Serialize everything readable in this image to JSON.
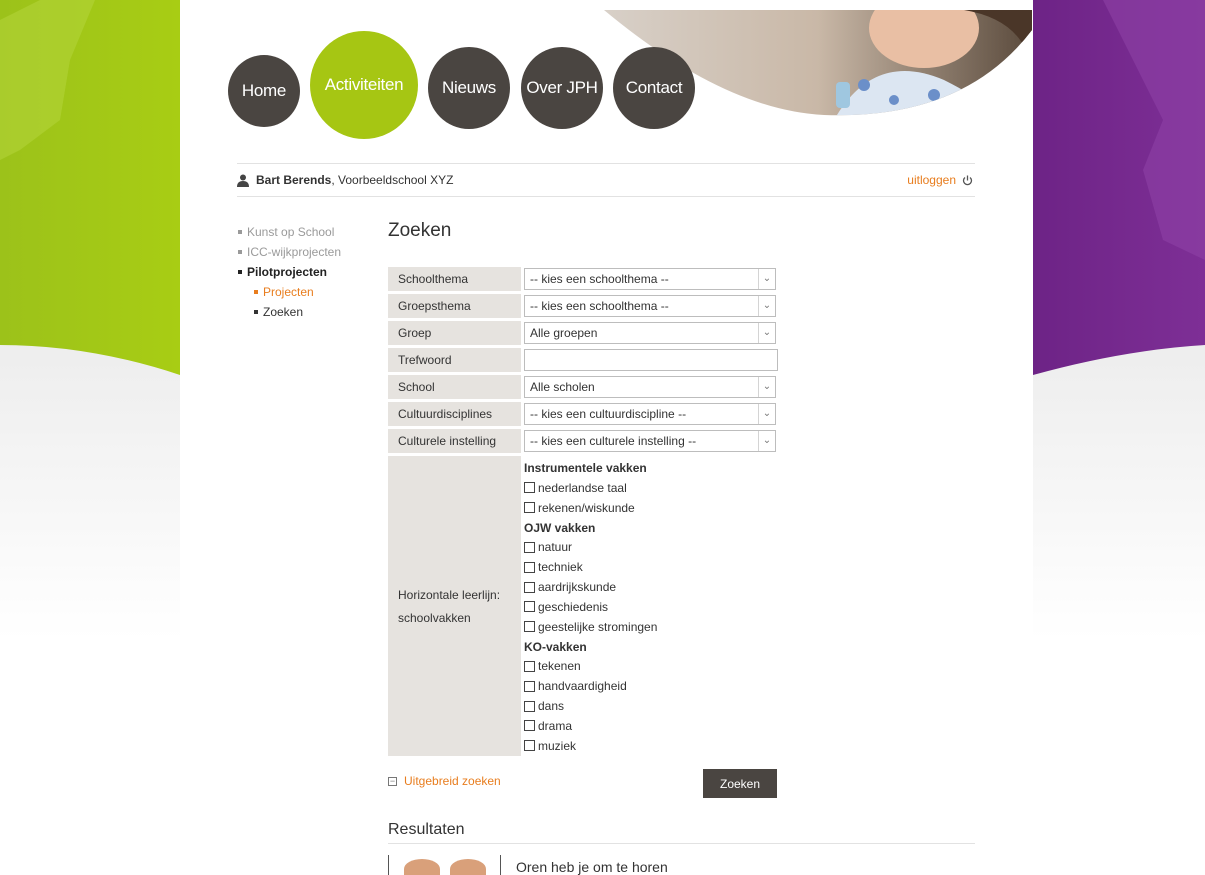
{
  "nav": [
    {
      "label": "Home",
      "active": false
    },
    {
      "label": "Activiteiten",
      "active": true
    },
    {
      "label": "Nieuws",
      "active": false
    },
    {
      "label": "Over JPH",
      "active": false
    },
    {
      "label": "Contact",
      "active": false
    }
  ],
  "user": {
    "name": "Bart Berends",
    "school": ", Voorbeeldschool XYZ",
    "icon": "user-icon"
  },
  "logout": {
    "label": "uitloggen",
    "icon": "power-icon"
  },
  "sidebar": {
    "items": [
      {
        "label": "Kunst op School"
      },
      {
        "label": "ICC-wijkprojecten"
      },
      {
        "label": "Pilotprojecten"
      }
    ],
    "subitems": [
      {
        "label": "Projecten"
      },
      {
        "label": "Zoeken"
      }
    ]
  },
  "page_title": "Zoeken",
  "form": {
    "schoolthema": {
      "label": "Schoolthema",
      "value": "-- kies een schoolthema --"
    },
    "groepsthema": {
      "label": "Groepsthema",
      "value": "-- kies een schoolthema --"
    },
    "groep": {
      "label": "Groep",
      "value": "Alle groepen"
    },
    "trefwoord": {
      "label": "Trefwoord",
      "value": ""
    },
    "school": {
      "label": "School",
      "value": "Alle scholen"
    },
    "cultuurdisciplines": {
      "label": "Cultuurdisciplines",
      "value": "-- kies een cultuurdiscipline --"
    },
    "culturele_instelling": {
      "label": "Culturele instelling",
      "value": "-- kies een culturele instelling --"
    },
    "leerlijn": {
      "label_line1": "Horizontale leerlijn:",
      "label_line2": "schoolvakken",
      "groups": [
        {
          "title": "Instrumentele vakken",
          "items": [
            "nederlandse taal",
            "rekenen/wiskunde"
          ]
        },
        {
          "title": "OJW vakken",
          "items": [
            "natuur",
            "techniek",
            "aardrijkskunde",
            "geschiedenis",
            "geestelijke stromingen"
          ]
        },
        {
          "title": "KO-vakken",
          "items": [
            "tekenen",
            "handvaardigheid",
            "dans",
            "drama",
            "muziek"
          ]
        }
      ]
    }
  },
  "advanced": {
    "label": "Uitgebreid zoeken",
    "icon": "collapse-icon"
  },
  "search_button": "Zoeken",
  "results": {
    "heading": "Resultaten",
    "first_title": "Oren heb je om te horen"
  },
  "colors": {
    "accent_green": "#a6c613",
    "dark": "#4a4541",
    "orange": "#e87d1e",
    "purple": "#7a2a8e"
  }
}
